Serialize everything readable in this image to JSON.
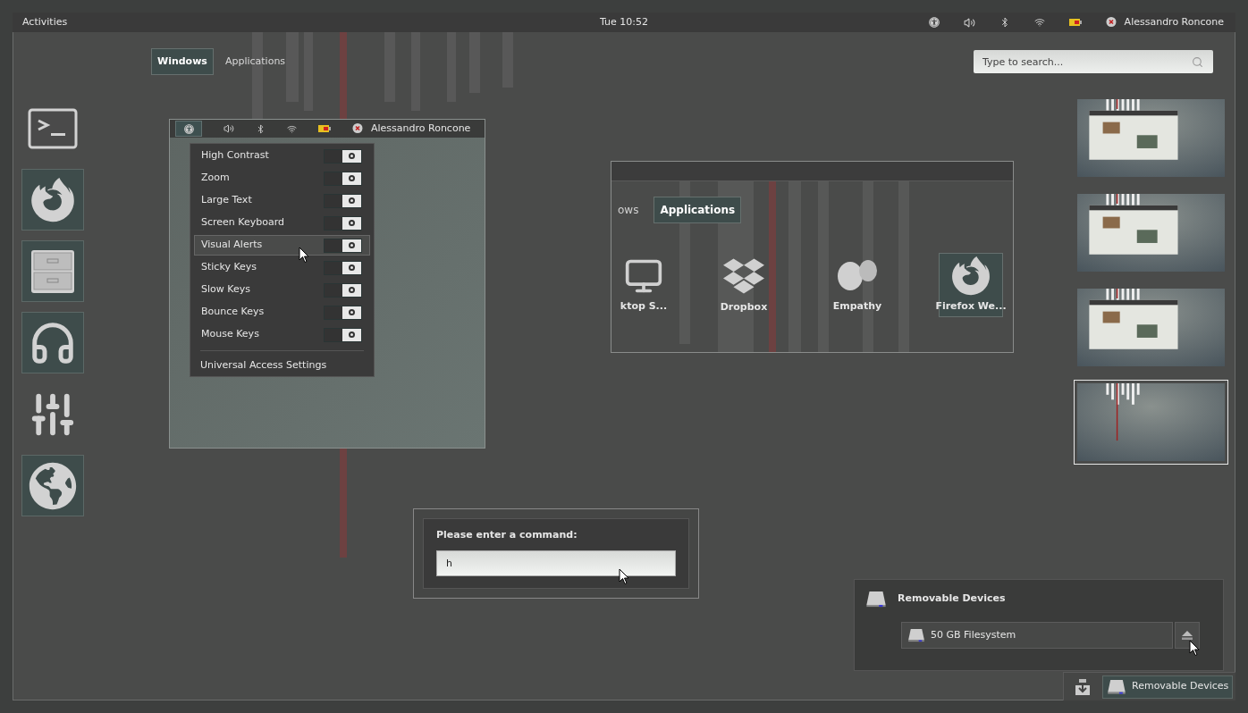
{
  "top_bar": {
    "activities": "Activities",
    "clock": "Tue 10:52",
    "user": "Alessandro Roncone"
  },
  "view_tabs": [
    {
      "label": "Windows",
      "selected": true
    },
    {
      "label": "Applications",
      "selected": false
    }
  ],
  "search": {
    "placeholder": "Type to search..."
  },
  "dock": [
    {
      "kind": "terminal",
      "running": false
    },
    {
      "kind": "firefox",
      "running": true
    },
    {
      "kind": "files",
      "running": true
    },
    {
      "kind": "headphones",
      "running": true
    },
    {
      "kind": "sliders",
      "running": false
    },
    {
      "kind": "globe",
      "running": true
    }
  ],
  "status_menu": {
    "user": "Alessandro Roncone",
    "items": [
      {
        "label": "High Contrast",
        "on": false,
        "selected": false
      },
      {
        "label": "Zoom",
        "on": false,
        "selected": false
      },
      {
        "label": "Large Text",
        "on": false,
        "selected": false
      },
      {
        "label": "Screen Keyboard",
        "on": false,
        "selected": false
      },
      {
        "label": "Visual Alerts",
        "on": false,
        "selected": true
      },
      {
        "label": "Sticky Keys",
        "on": false,
        "selected": false
      },
      {
        "label": "Slow Keys",
        "on": false,
        "selected": false
      },
      {
        "label": "Bounce Keys",
        "on": false,
        "selected": false
      },
      {
        "label": "Mouse Keys",
        "on": false,
        "selected": false
      }
    ],
    "settings": "Universal Access Settings"
  },
  "app_switcher": {
    "tabs": [
      {
        "label": "ows",
        "selected": false
      },
      {
        "label": "Applications",
        "selected": true
      }
    ],
    "apps": [
      {
        "kind": "desktop",
        "label": "ktop S...",
        "selected": false
      },
      {
        "kind": "dropbox",
        "label": "Dropbox",
        "selected": false
      },
      {
        "kind": "empathy",
        "label": "Empathy",
        "selected": false
      },
      {
        "kind": "firefox",
        "label": "Firefox We...",
        "selected": true
      }
    ]
  },
  "workspaces": [
    {
      "selected": false
    },
    {
      "selected": false
    },
    {
      "selected": false
    },
    {
      "selected": true
    }
  ],
  "run_dialog": {
    "prompt": "Please enter a command:",
    "value": "h"
  },
  "notification": {
    "title": "Removable Devices",
    "device": "50 GB Filesystem"
  },
  "message_tray": {
    "label": "Removable Devices"
  }
}
